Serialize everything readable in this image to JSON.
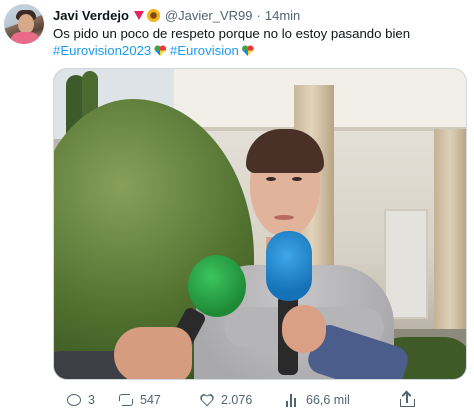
{
  "tweet": {
    "author": {
      "name": "Javi Verdejo",
      "handle": "@Javier_VR99",
      "separator": "·",
      "time": "14min"
    },
    "text": {
      "line1": "Os pido un poco de respeto porque no lo estoy pasando bien",
      "hashtag1": "#Eurovision2023",
      "hashtag2": "#Eurovision"
    },
    "actions": {
      "replies": "3",
      "retweets": "547",
      "likes": "2.076",
      "views": "66,6 mil"
    }
  },
  "colors": {
    "link": "#1d9bf0",
    "text": "#0f1419",
    "secondary": "#536471"
  }
}
